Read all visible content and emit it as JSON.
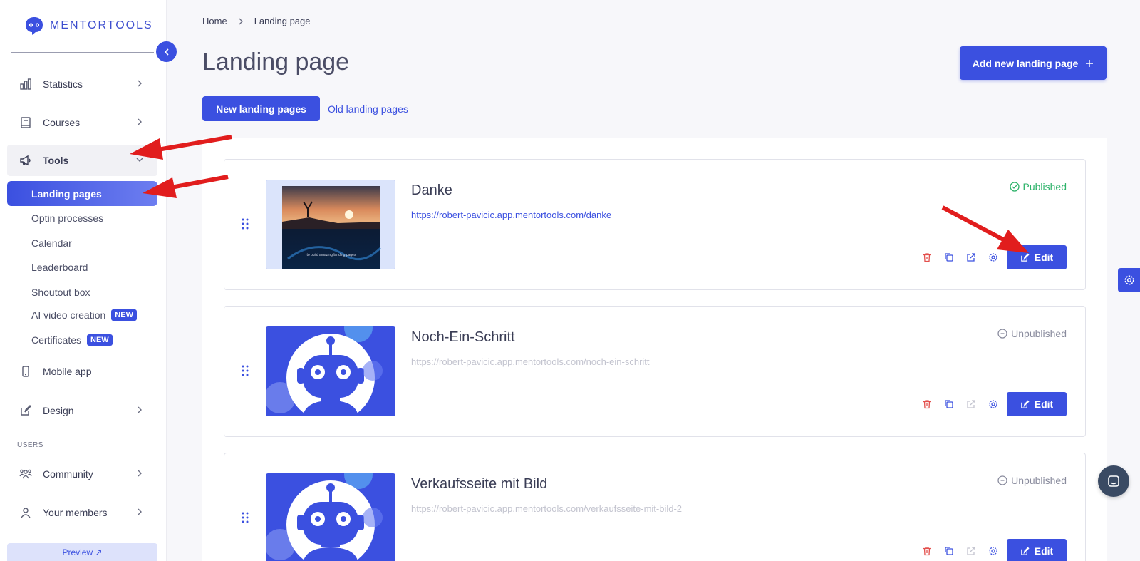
{
  "brand": {
    "name": "MENTORTOOLS",
    "accent": "#3b50e0"
  },
  "sidebar": {
    "items": [
      {
        "label": "Statistics"
      },
      {
        "label": "Courses"
      },
      {
        "label": "Tools"
      },
      {
        "label": "Mobile app"
      },
      {
        "label": "Design"
      },
      {
        "label": "Community"
      },
      {
        "label": "Your members"
      }
    ],
    "tools_sub": [
      {
        "label": "Landing pages"
      },
      {
        "label": "Optin processes"
      },
      {
        "label": "Calendar"
      },
      {
        "label": "Leaderboard"
      },
      {
        "label": "Shoutout box"
      },
      {
        "label": "AI video creation",
        "badge": "NEW"
      },
      {
        "label": "Certificates",
        "badge": "NEW"
      }
    ],
    "section_users": "USERS",
    "preview": "Preview ↗"
  },
  "breadcrumb": {
    "home": "Home",
    "current": "Landing page"
  },
  "page": {
    "title": "Landing page",
    "add_button": "Add new landing page",
    "tab_new": "New landing pages",
    "tab_old": "Old landing pages"
  },
  "cards": [
    {
      "title": "Danke",
      "url": "https://robert-pavicic.app.mentortools.com/danke",
      "status": "Published",
      "edit": "Edit",
      "thumb_caption": "to build amazing landing pages"
    },
    {
      "title": "Noch-Ein-Schritt",
      "url": "https://robert-pavicic.app.mentortools.com/noch-ein-schritt",
      "status": "Unpublished",
      "edit": "Edit"
    },
    {
      "title": "Verkaufsseite mit Bild",
      "url": "https://robert-pavicic.app.mentortools.com/verkaufsseite-mit-bild-2",
      "status": "Unpublished",
      "edit": "Edit"
    }
  ]
}
